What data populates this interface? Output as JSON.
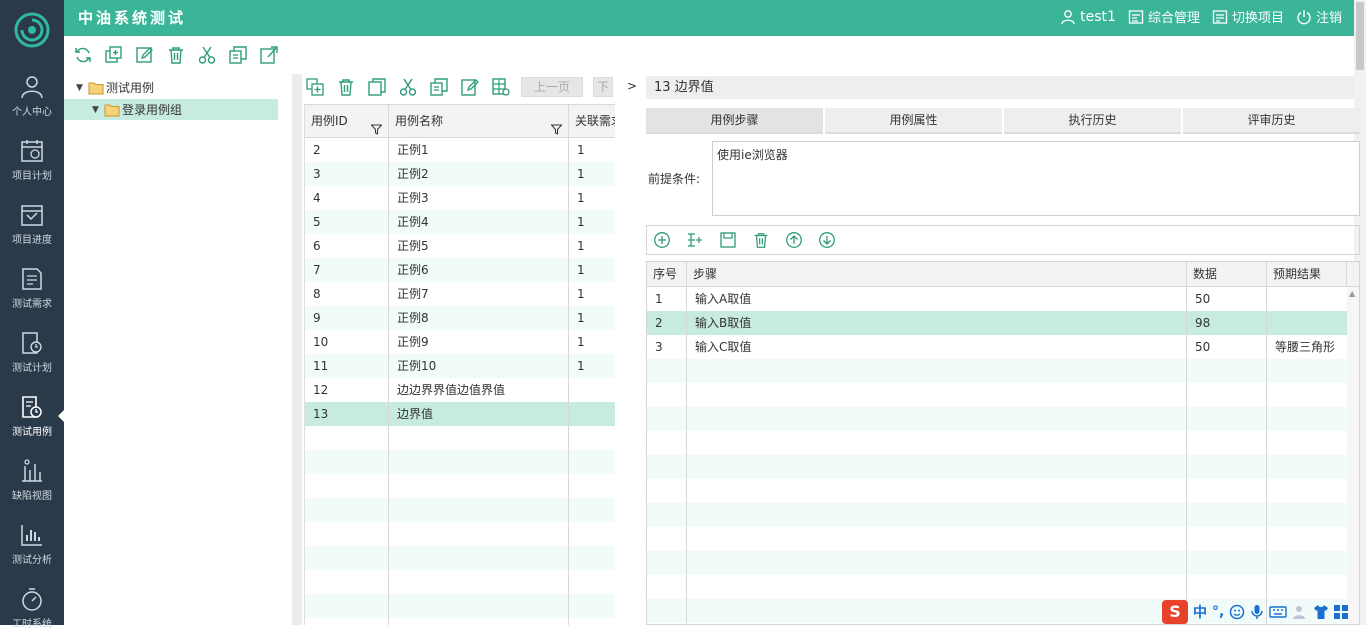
{
  "header": {
    "app_title": "中油系统测试",
    "user": "test1",
    "menu": [
      "综合管理",
      "切换项目",
      "注销"
    ]
  },
  "sidebar": {
    "items": [
      {
        "label": "个人中心",
        "icon": "person-icon"
      },
      {
        "label": "项目计划",
        "icon": "calendar-icon"
      },
      {
        "label": "项目进度",
        "icon": "progress-icon"
      },
      {
        "label": "测试需求",
        "icon": "requirement-icon"
      },
      {
        "label": "测试计划",
        "icon": "plan-icon"
      },
      {
        "label": "测试用例",
        "icon": "testcase-icon"
      },
      {
        "label": "缺陷视图",
        "icon": "bug-icon"
      },
      {
        "label": "测试分析",
        "icon": "chart-icon"
      },
      {
        "label": "工时系统",
        "icon": "stopwatch-icon"
      }
    ],
    "active_index": 5
  },
  "tree": {
    "root": "测试用例",
    "child": "登录用例组"
  },
  "case_toolbar": {
    "prev_page": "上一页",
    "next_page": "下"
  },
  "case_grid": {
    "columns": [
      "用例ID",
      "用例名称",
      "关联需求"
    ],
    "rows": [
      {
        "id": "2",
        "name": "正例1",
        "req": "1"
      },
      {
        "id": "3",
        "name": "正例2",
        "req": "1"
      },
      {
        "id": "4",
        "name": "正例3",
        "req": "1"
      },
      {
        "id": "5",
        "name": "正例4",
        "req": "1"
      },
      {
        "id": "6",
        "name": "正例5",
        "req": "1"
      },
      {
        "id": "7",
        "name": "正例6",
        "req": "1"
      },
      {
        "id": "8",
        "name": "正例7",
        "req": "1"
      },
      {
        "id": "9",
        "name": "正例8",
        "req": "1"
      },
      {
        "id": "10",
        "name": "正例9",
        "req": "1"
      },
      {
        "id": "11",
        "name": "正例10",
        "req": "1"
      },
      {
        "id": "12",
        "name": "边边界界值边值界值",
        "req": ""
      },
      {
        "id": "13",
        "name": "边界值",
        "req": ""
      }
    ],
    "selected_index": 11
  },
  "detail": {
    "crumb": ">",
    "title": "13   边界值",
    "tabs": [
      "用例步骤",
      "用例属性",
      "执行历史",
      "评审历史"
    ],
    "active_tab": 0,
    "precondition_label": "前提条件:",
    "precondition_value": "使用ie浏览器"
  },
  "step_grid": {
    "columns": [
      "序号",
      "步骤",
      "数据",
      "预期结果"
    ],
    "rows": [
      {
        "no": "1",
        "step": "输入A取值",
        "data": "50",
        "expect": ""
      },
      {
        "no": "2",
        "step": "输入B取值",
        "data": "98",
        "expect": ""
      },
      {
        "no": "3",
        "step": "输入C取值",
        "data": "50",
        "expect": "等腰三角形"
      }
    ],
    "selected_index": 1
  },
  "ime": {
    "logo": "S",
    "lang": "中",
    "punct": "°,"
  },
  "colors": {
    "header": "#3bb597",
    "sidebar": "#2b3a4a",
    "selection": "#c7ebe0",
    "icon_green": "#2e9c7c"
  }
}
